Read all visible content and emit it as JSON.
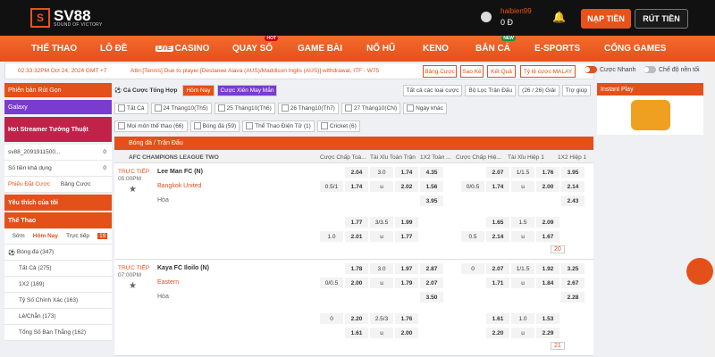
{
  "logo": {
    "mark": "S",
    "brand": "SV88",
    "tagline": "SOUND OF VICTORY"
  },
  "user": {
    "name": "haibien99",
    "balance": "0 Đ"
  },
  "top_buttons": {
    "deposit": "NẠP TIỀN",
    "withdraw": "RÚT TIỀN"
  },
  "nav": {
    "items": [
      {
        "label": "THỂ THAO"
      },
      {
        "label": "LÔ ĐỀ"
      },
      {
        "label": "CASINO",
        "live": "LIVE"
      },
      {
        "label": "QUAY SỐ",
        "badge": "HOT"
      },
      {
        "label": "GAME BÀI"
      },
      {
        "label": "NỔ HŨ"
      },
      {
        "label": "KENO"
      },
      {
        "label": "BẮN CÁ",
        "badge": "NEW"
      },
      {
        "label": "E-SPORTS"
      },
      {
        "label": "CỔNG GAMES"
      }
    ]
  },
  "ticker": {
    "time": "02:33:32PM Oct 24, 2024 GMT +7",
    "message": "Attn:[Tennis] Due to player [Destanee Aiava (AUS)/Maddison Inglis (AUS)] withdrawal, ITF - W75",
    "buttons": [
      "Bảng Cược",
      "Sao Kê",
      "Kết Quả",
      "Tỷ lệ cược MALAY"
    ],
    "fast_bet": "Cược Nhanh",
    "dark_mode": "Chế độ nền tối"
  },
  "left": {
    "banners": [
      "Phiên bản Rút Gọn",
      "Galaxy",
      "Hot Streamer Tướng Thuật"
    ],
    "account": "sv88_2091911500...",
    "account_count": "0",
    "balance_label": "Số tiền khả dụng",
    "balance_value": "0",
    "tabs": [
      "Phiếu Đặt Cược",
      "Bảng Cược"
    ],
    "favorites": "Yêu thích của tôi",
    "sports_label": "Thể Thao",
    "sub_tabs": [
      "Sớm",
      "Hôm Nay",
      "Trực tiếp"
    ],
    "live_count": "19",
    "sport": "Bóng đá",
    "sport_count": "(347)",
    "items": [
      {
        "label": "Tất Cả",
        "count": "(275)"
      },
      {
        "label": "1X2",
        "count": "(189)"
      },
      {
        "label": "Tỷ Số Chính Xác",
        "count": "(163)"
      },
      {
        "label": "Lẻ/Chẵn",
        "count": "(173)"
      },
      {
        "label": "Tổng Số Bàn Thắng",
        "count": "(162)"
      }
    ]
  },
  "filters": {
    "title": "Cá Cược Tổng Hợp",
    "today": "Hôm Nay",
    "combo": "Cược Xiên May Mắn",
    "all_types": "Tất cả các loại cược",
    "league_filter": "Bộ Lọc Trận Đấu",
    "page": "(26 / 26) Giải",
    "help": "Trợ giúp",
    "chips": [
      "Tất Cả",
      "24 Tháng10(Th5)",
      "25 Tháng10(Th6)",
      "26 Tháng10(Th7)",
      "27 Tháng10(CN)",
      "Ngày khác"
    ],
    "sports": [
      "Mọi môn thể thao (66)",
      "Bóng đá (59)",
      "Thể Thao Điện Tử (1)",
      "Cricket (6)"
    ]
  },
  "section": "Bóng đá / Trận Đấu",
  "league": {
    "name": "AFC CHAMPIONS LEAGUE TWO",
    "cols": [
      "Cược Chấp Toà...",
      "Tài Xỉu Toàn Trận",
      "1X2 Toàn ...",
      "Cược Chấp Hiệ...",
      "Tài Xỉu Hiệp 1",
      "1X2 Hiệp 1"
    ]
  },
  "matches": [
    {
      "status": "TRỰC TIẾP",
      "time": "05:00PM",
      "home": "Lee Man FC (N)",
      "away": "Bangkok United",
      "draw": "Hòa",
      "more": "20",
      "rows": [
        [
          "",
          "2.04",
          "3.0",
          "1.74",
          "4.35",
          "",
          "2.07",
          "1/1.5",
          "1.76",
          "3.95"
        ],
        [
          "0.5/1",
          "1.74",
          "u",
          "2.02",
          "1.56",
          "0/0.5",
          "1.74",
          "u",
          "2.00",
          "2.14"
        ],
        [
          "",
          "",
          "",
          "",
          "3.95",
          "",
          "",
          "",
          "",
          "2.43"
        ],
        [
          "",
          "1.77",
          "3/3.5",
          "1.99",
          "",
          "",
          "1.65",
          "1.5",
          "2.09",
          ""
        ],
        [
          "1.0",
          "2.01",
          "u",
          "1.77",
          "",
          "0.5",
          "2.14",
          "u",
          "1.67",
          ""
        ]
      ]
    },
    {
      "status": "TRỰC TIẾP",
      "time": "07:00PM",
      "home": "Kaya FC Iloilo (N)",
      "away": "Eastern",
      "draw": "Hòa",
      "more": "21",
      "rows": [
        [
          "",
          "1.78",
          "3.0",
          "1.97",
          "2.87",
          "0",
          "2.07",
          "1/1.5",
          "1.92",
          "3.25"
        ],
        [
          "0/0.5",
          "2.00",
          "u",
          "1.79",
          "2.07",
          "",
          "1.71",
          "u",
          "1.84",
          "2.67"
        ],
        [
          "",
          "",
          "",
          "",
          "3.50",
          "",
          "",
          "",
          "",
          "2.28"
        ],
        [
          "0",
          "2.20",
          "2.5/3",
          "1.76",
          "",
          "",
          "1.61",
          "1.0",
          "1.53",
          ""
        ],
        [
          "",
          "1.61",
          "u",
          "2.00",
          "",
          "",
          "2.20",
          "u",
          "2.29",
          ""
        ]
      ]
    }
  ],
  "right": {
    "instant_play": "Instant Play"
  }
}
